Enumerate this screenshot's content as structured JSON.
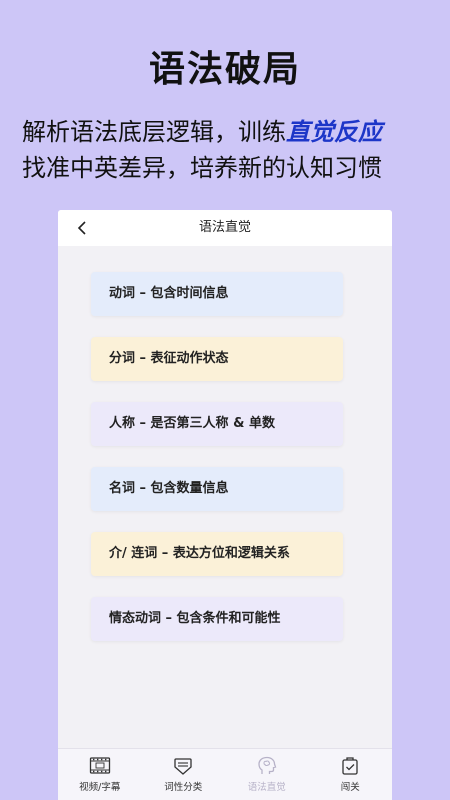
{
  "promo": {
    "headline": "语法破局",
    "line1_prefix": "解析语法底层逻辑，训练",
    "line1_accent": "直觉反应",
    "line2": "找准中英差异，培养新的认知习惯"
  },
  "screen": {
    "title": "语法直觉",
    "cards": [
      {
        "label": "动词 – 包含时间信息",
        "color": "#e4ecfb"
      },
      {
        "label": "分词 – 表征动作状态",
        "color": "#fbf1d8"
      },
      {
        "label": "人称 – 是否第三人称 & 单数",
        "color": "#ece9fa"
      },
      {
        "label": "名词 – 包含数量信息",
        "color": "#e4ecfb"
      },
      {
        "label": "介/ 连词 – 表达方位和逻辑关系",
        "color": "#fbf1d8"
      },
      {
        "label": "情态动词 – 包含条件和可能性",
        "color": "#ece9fa"
      }
    ],
    "tabs": [
      {
        "label": "视频/字幕",
        "icon": "video-subtitle-icon"
      },
      {
        "label": "词性分类",
        "icon": "word-class-icon"
      },
      {
        "label": "语法直觉",
        "icon": "head-icon",
        "active": true
      },
      {
        "label": "闯关",
        "icon": "level-check-icon"
      }
    ]
  }
}
